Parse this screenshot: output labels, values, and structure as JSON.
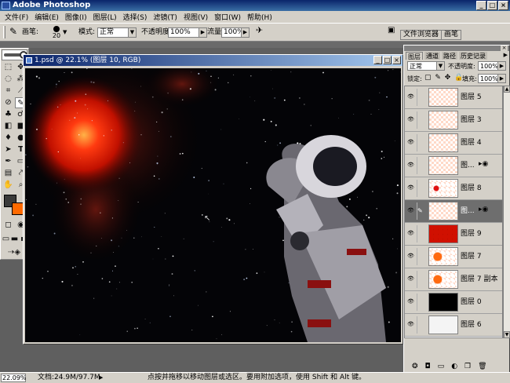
{
  "app": {
    "title": "Adobe Photoshop"
  },
  "window_buttons": [
    "_",
    "□",
    "×"
  ],
  "menu": [
    "文件(F)",
    "编辑(E)",
    "图像(I)",
    "图层(L)",
    "选择(S)",
    "滤镜(T)",
    "视图(V)",
    "窗口(W)",
    "帮助(H)"
  ],
  "options": {
    "brush_label": "画笔:",
    "brush_size": "20",
    "mode_label": "模式:",
    "mode_value": "正常",
    "opacity_label": "不透明度:",
    "opacity_value": "100%",
    "flow_label": "流量:",
    "flow_value": "100%",
    "tabs": [
      "文件浏览器",
      "画笔"
    ]
  },
  "document": {
    "title": "1.psd @ 22.1% (图层 10, RGB)"
  },
  "layers_panel": {
    "tabs": [
      "图层",
      "通道",
      "路径",
      "历史记录"
    ],
    "blend_mode": "正常",
    "opacity_label": "不透明度:",
    "opacity_value": "100%",
    "lock_label": "锁定:",
    "fill_label": "填充:",
    "fill_value": "100%",
    "layers": [
      {
        "name": "图层 5",
        "thumb": "checker"
      },
      {
        "name": "图层 3",
        "thumb": "checker"
      },
      {
        "name": "图层 4",
        "thumb": "checker"
      },
      {
        "name": "图...",
        "thumb": "checker"
      },
      {
        "name": "图层 8",
        "thumb": "red-dot"
      },
      {
        "name": "图...",
        "thumb": "checker"
      },
      {
        "name": "图层 9",
        "thumb": "space"
      },
      {
        "name": "图层 7",
        "thumb": "orange"
      },
      {
        "name": "图层 7 副本",
        "thumb": "orange"
      },
      {
        "name": "图层 0",
        "thumb": "black"
      },
      {
        "name": "图层 6",
        "thumb": "sketch"
      }
    ]
  },
  "status": {
    "zoom": "22.09%",
    "doc_size": "文档:24.9M/97.7M",
    "hint": "点按并拖移以移动图层或选区。要用附加选项，使用 Shift 和 Alt 键。"
  },
  "colors": {
    "accent": "#0a246a",
    "foreground": "#3a3a3a",
    "background": "#ff6a00"
  }
}
